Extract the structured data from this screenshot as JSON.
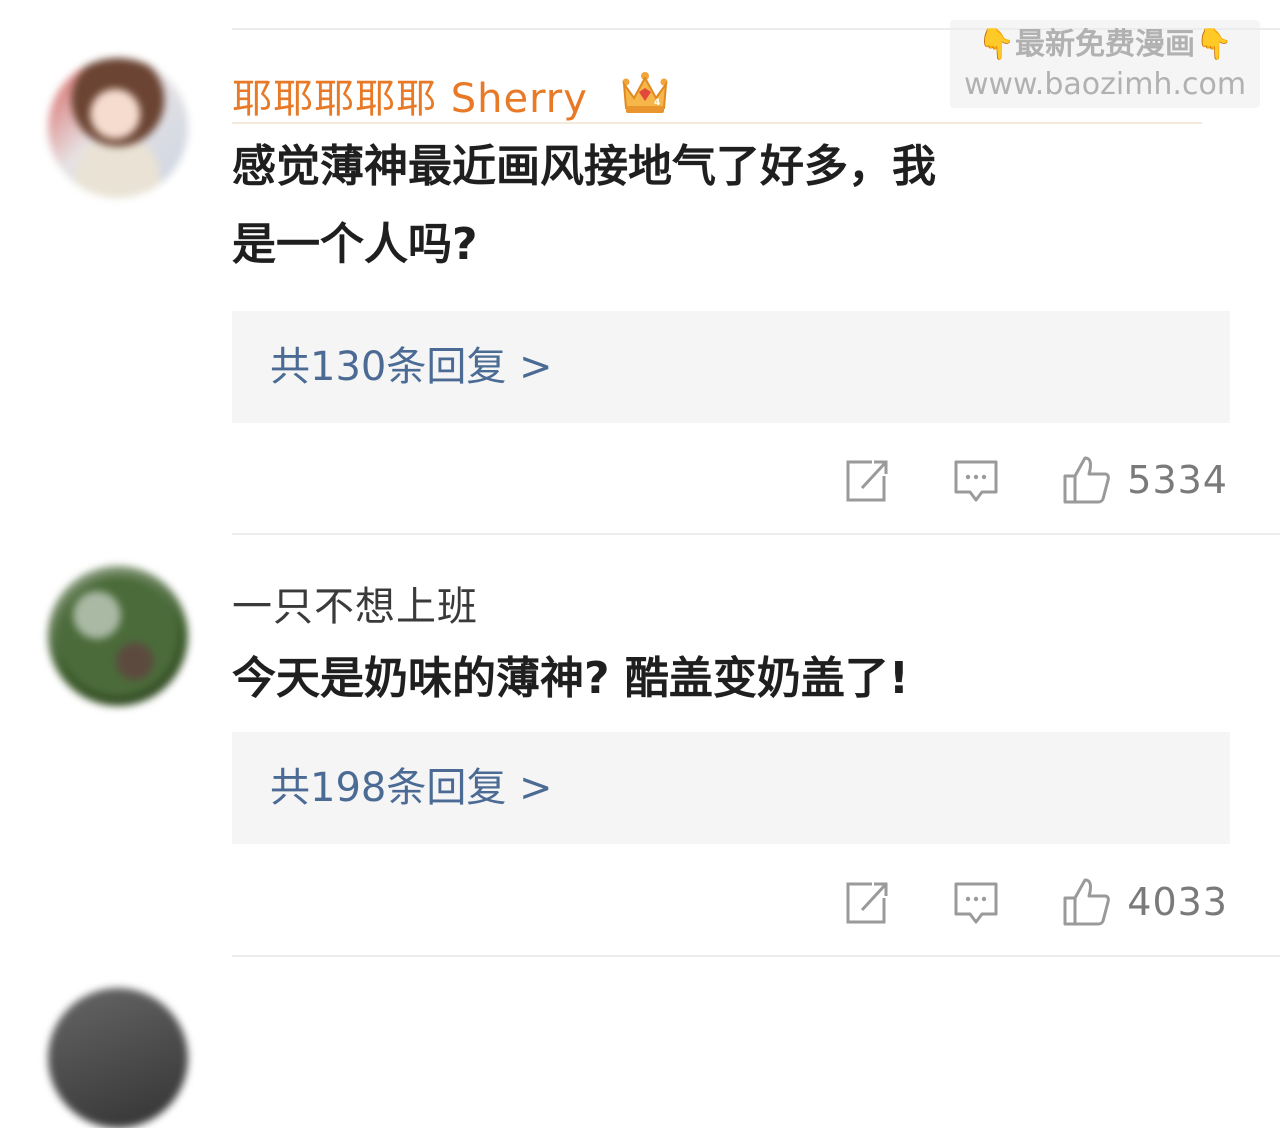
{
  "watermark": {
    "line1": "最新免费漫画",
    "line2": "www.baozimh.com",
    "finger_left": "👇",
    "finger_right": "👇"
  },
  "comments": [
    {
      "name": "耶耶耶耶耶 Sherry",
      "name_color": "#e87a27",
      "vip_badge": "crown-icon",
      "content_line1": "感觉薄神最近画风接地气了好多，我",
      "content_line2": "是一个人吗?",
      "reply_label": "共130条回复 >",
      "like_count": "5334"
    },
    {
      "name": "一只不想上班",
      "name_color": "#3a3a3a",
      "content_line1": "今天是奶味的薄神? 酷盖变奶盖了!",
      "reply_label": "共198条回复 >",
      "like_count": "4033"
    }
  ],
  "colors": {
    "reply_link": "#4b6b95",
    "reply_bg": "#f5f5f5",
    "divider": "#ececec"
  }
}
